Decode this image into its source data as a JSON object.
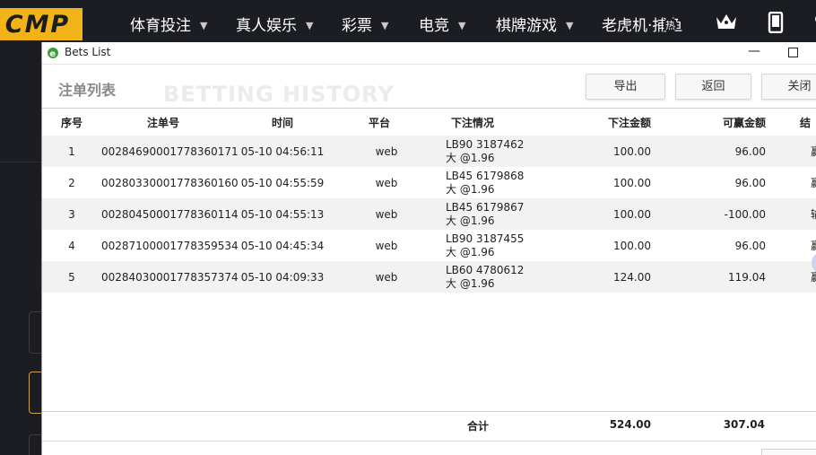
{
  "topbar": {
    "logo_text": "CMP",
    "nav": [
      {
        "label": "体育投注"
      },
      {
        "label": "真人娱乐"
      },
      {
        "label": "彩票"
      },
      {
        "label": "电竞"
      },
      {
        "label": "棋牌游戏"
      },
      {
        "label": "老虎机·捕鱼"
      }
    ],
    "hot_badge": "热",
    "icons": [
      "crown-icon",
      "mobile-icon"
    ]
  },
  "window": {
    "title": "Bets List",
    "minimize_glyph": "—",
    "toolbar_title": "注单列表",
    "watermark": "BETTING HISTORY",
    "buttons": {
      "export": "导出",
      "back": "返回",
      "close": "关闭"
    }
  },
  "table": {
    "columns": [
      "序号",
      "注单号",
      "时间",
      "平台",
      "下注情况",
      "下注金额",
      "可赢金额",
      "结"
    ],
    "rows": [
      {
        "no": "1",
        "bet_id": "00284690001778360171",
        "time": "05-10 04:56:11",
        "platform": "web",
        "detail_line1": "LB90 3187462",
        "detail_line2": "大 @1.96",
        "stake": "100.00",
        "win": "96.00",
        "result": "赢"
      },
      {
        "no": "2",
        "bet_id": "00280330001778360160",
        "time": "05-10 04:55:59",
        "platform": "web",
        "detail_line1": "LB45 6179868",
        "detail_line2": "大 @1.96",
        "stake": "100.00",
        "win": "96.00",
        "result": "赢"
      },
      {
        "no": "3",
        "bet_id": "00280450001778360114",
        "time": "05-10 04:55:13",
        "platform": "web",
        "detail_line1": "LB45 6179867",
        "detail_line2": "大 @1.96",
        "stake": "100.00",
        "win": "-100.00",
        "result": "输"
      },
      {
        "no": "4",
        "bet_id": "00287100001778359534",
        "time": "05-10 04:45:34",
        "platform": "web",
        "detail_line1": "LB90 3187455",
        "detail_line2": "大 @1.96",
        "stake": "100.00",
        "win": "96.00",
        "result": "赢"
      },
      {
        "no": "5",
        "bet_id": "00284030001778357374",
        "time": "05-10 04:09:33",
        "platform": "web",
        "detail_line1": "LB60 4780612",
        "detail_line2": "大 @1.96",
        "stake": "124.00",
        "win": "119.04",
        "result": "赢"
      }
    ],
    "total_label": "合计",
    "total_stake": "524.00",
    "total_win": "307.04"
  },
  "colors": {
    "brand": "#f2b318",
    "nav_bg": "#1b1d22",
    "row_stripe": "#f2f2f2"
  }
}
